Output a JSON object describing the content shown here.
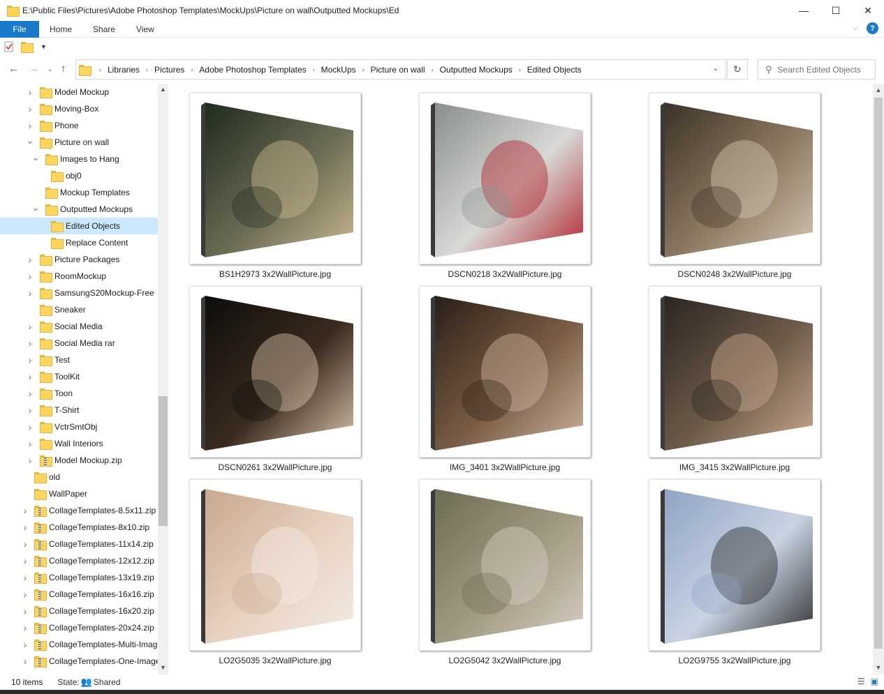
{
  "window": {
    "title": "E:\\Public Files\\Pictures\\Adobe Photoshop Templates\\MockUps\\Picture on wall\\Outputted Mockups\\Ed",
    "minimize": "—",
    "maximize": "☐",
    "close": "✕"
  },
  "ribbon": {
    "tabs": [
      "File",
      "Home",
      "Share",
      "View"
    ],
    "help": "?"
  },
  "address": {
    "crumbs": [
      "Libraries",
      "Pictures",
      "Adobe Photoshop Templates",
      "MockUps",
      "Picture on wall",
      "Outputted Mockups",
      "Edited Objects"
    ]
  },
  "search": {
    "placeholder": "Search Edited Objects"
  },
  "tree": [
    {
      "label": "Model Mockup",
      "indent": 1,
      "expand": "collapsed",
      "icon": "folder"
    },
    {
      "label": "Moving-Box",
      "indent": 1,
      "expand": "collapsed",
      "icon": "folder"
    },
    {
      "label": "Phone",
      "indent": 1,
      "expand": "collapsed",
      "icon": "folder"
    },
    {
      "label": "Picture on wall",
      "indent": 1,
      "expand": "expanded",
      "icon": "folder"
    },
    {
      "label": "Images to Hang",
      "indent": 2,
      "expand": "expanded",
      "icon": "folder"
    },
    {
      "label": "obj0",
      "indent": 3,
      "expand": "none",
      "icon": "folder"
    },
    {
      "label": "Mockup Templates",
      "indent": 2,
      "expand": "none",
      "icon": "folder"
    },
    {
      "label": "Outputted Mockups",
      "indent": 2,
      "expand": "expanded",
      "icon": "folder"
    },
    {
      "label": "Edited Objects",
      "indent": 3,
      "expand": "none",
      "icon": "folder",
      "selected": true
    },
    {
      "label": "Replace Content",
      "indent": 3,
      "expand": "none",
      "icon": "folder"
    },
    {
      "label": "Picture Packages",
      "indent": 1,
      "expand": "collapsed",
      "icon": "folder"
    },
    {
      "label": "RoomMockup",
      "indent": 1,
      "expand": "collapsed",
      "icon": "folder"
    },
    {
      "label": "SamsungS20Mockup-Free",
      "indent": 1,
      "expand": "collapsed",
      "icon": "folder"
    },
    {
      "label": "Sneaker",
      "indent": 1,
      "expand": "none",
      "icon": "folder"
    },
    {
      "label": "Social Media",
      "indent": 1,
      "expand": "collapsed",
      "icon": "folder"
    },
    {
      "label": "Social Media rar",
      "indent": 1,
      "expand": "collapsed",
      "icon": "folder"
    },
    {
      "label": "Test",
      "indent": 1,
      "expand": "collapsed",
      "icon": "folder"
    },
    {
      "label": "ToolKit",
      "indent": 1,
      "expand": "collapsed",
      "icon": "folder"
    },
    {
      "label": "Toon",
      "indent": 1,
      "expand": "collapsed",
      "icon": "folder"
    },
    {
      "label": "T-Shirt",
      "indent": 1,
      "expand": "collapsed",
      "icon": "folder"
    },
    {
      "label": "VctrSmtObj",
      "indent": 1,
      "expand": "collapsed",
      "icon": "folder"
    },
    {
      "label": "Wall Interiors",
      "indent": 1,
      "expand": "collapsed",
      "icon": "folder"
    },
    {
      "label": "Model Mockup.zip",
      "indent": 1,
      "expand": "collapsed",
      "icon": "zip"
    },
    {
      "label": "old",
      "indent": 0,
      "expand": "none",
      "icon": "folder"
    },
    {
      "label": "WallPaper",
      "indent": 0,
      "expand": "none",
      "icon": "folder"
    },
    {
      "label": "CollageTemplates-8.5x11.zip",
      "indent": 0,
      "expand": "collapsed",
      "icon": "zip"
    },
    {
      "label": "CollageTemplates-8x10.zip",
      "indent": 0,
      "expand": "collapsed",
      "icon": "zip"
    },
    {
      "label": "CollageTemplates-11x14.zip",
      "indent": 0,
      "expand": "collapsed",
      "icon": "zip"
    },
    {
      "label": "CollageTemplates-12x12.zip",
      "indent": 0,
      "expand": "collapsed",
      "icon": "zip"
    },
    {
      "label": "CollageTemplates-13x19.zip",
      "indent": 0,
      "expand": "collapsed",
      "icon": "zip"
    },
    {
      "label": "CollageTemplates-16x16.zip",
      "indent": 0,
      "expand": "collapsed",
      "icon": "zip"
    },
    {
      "label": "CollageTemplates-16x20.zip",
      "indent": 0,
      "expand": "collapsed",
      "icon": "zip"
    },
    {
      "label": "CollageTemplates-20x24.zip",
      "indent": 0,
      "expand": "collapsed",
      "icon": "zip"
    },
    {
      "label": "CollageTemplates-Multi-Imag",
      "indent": 0,
      "expand": "collapsed",
      "icon": "zip"
    },
    {
      "label": "CollageTemplates-One-Image",
      "indent": 0,
      "expand": "collapsed",
      "icon": "zip"
    }
  ],
  "files": [
    {
      "name": "BS1H2973 3x2WallPicture.jpg",
      "colors": [
        "#1f2a1c",
        "#6b6c55",
        "#c9b98f"
      ]
    },
    {
      "name": "DSCN0218 3x2WallPicture.jpg",
      "colors": [
        "#8a8f8c",
        "#d9dad7",
        "#b0212a"
      ]
    },
    {
      "name": "DSCN0248 3x2WallPicture.jpg",
      "colors": [
        "#3b3226",
        "#8d7a63",
        "#d3c7b3"
      ]
    },
    {
      "name": "DSCN0261 3x2WallPicture.jpg",
      "colors": [
        "#0e0d0b",
        "#3a2b1f",
        "#d9c4ad"
      ]
    },
    {
      "name": "IMG_3401 3x2WallPicture.jpg",
      "colors": [
        "#2a1f18",
        "#7a5c45",
        "#cbb59f"
      ]
    },
    {
      "name": "IMG_3415 3x2WallPicture.jpg",
      "colors": [
        "#2a2420",
        "#6e5c4a",
        "#c9a990"
      ]
    },
    {
      "name": "LO2G5035 3x2WallPicture.jpg",
      "colors": [
        "#c9a88e",
        "#e8d3c3",
        "#f4ece5"
      ]
    },
    {
      "name": "LO2G5042 3x2WallPicture.jpg",
      "colors": [
        "#6d6b54",
        "#a39c84",
        "#d8cfc5"
      ]
    },
    {
      "name": "LO2G9755 3x2WallPicture.jpg",
      "colors": [
        "#8fa3c4",
        "#c9d4e3",
        "#2a2a2a"
      ]
    }
  ],
  "status": {
    "count": "10 items",
    "state_label": "State:",
    "state_value": "Shared"
  }
}
